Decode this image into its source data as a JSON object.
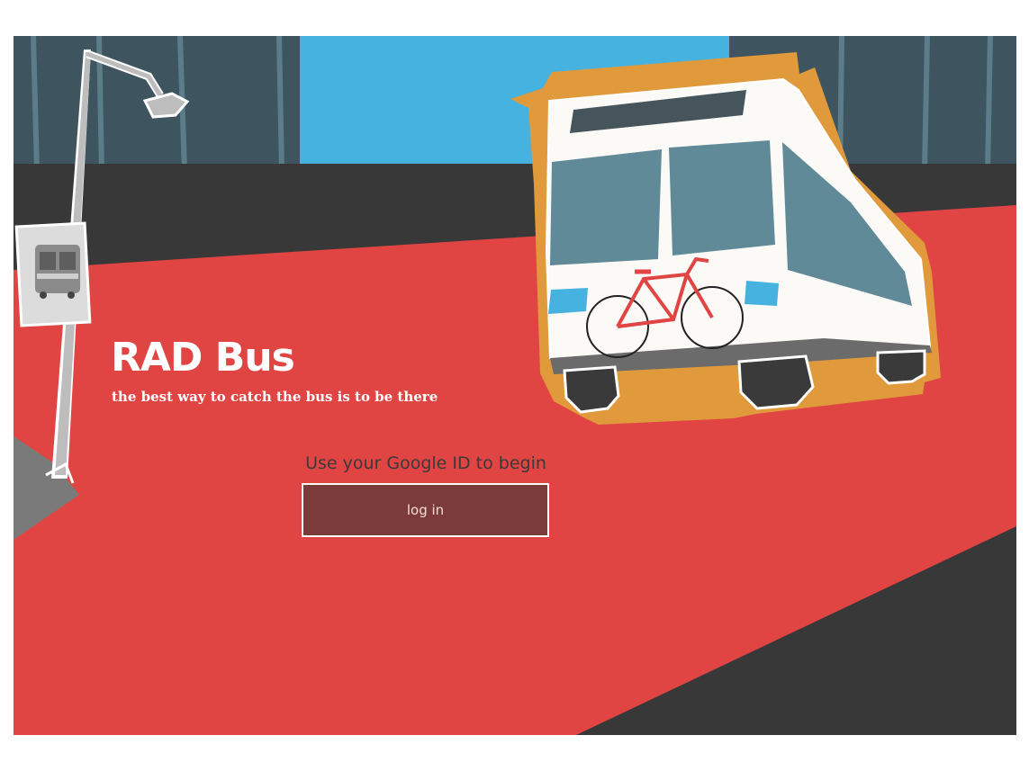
{
  "hero": {
    "title": "RAD Bus",
    "tagline": "the best way to catch the bus is to be there"
  },
  "login": {
    "prompt": "Use your Google ID to begin",
    "button_label": "log in"
  },
  "colors": {
    "sky": "#46b2e0",
    "buildings": "#3e555f",
    "road_dark": "#383838",
    "bus_lane": "#e04544",
    "bus_outline": "#e09a3c",
    "button_bg": "#7b3b3b"
  },
  "icons": [
    "street-lamp-icon",
    "bus-stop-sign-icon",
    "bus-illustration",
    "bicycle-icon"
  ]
}
